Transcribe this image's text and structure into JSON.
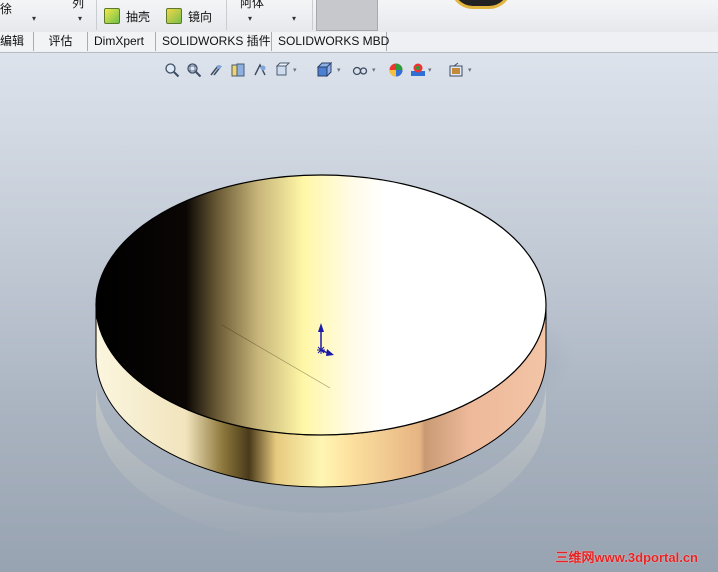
{
  "ribbon": {
    "partial_left": "徐",
    "partial_top1": "列",
    "shell_label": "抽壳",
    "mirror_label": "镜向",
    "partial_top2": "阿体",
    "dropdown_glyph": "▾"
  },
  "tabs": [
    {
      "label": "编辑"
    },
    {
      "label": "评估"
    },
    {
      "label": "DimXpert"
    },
    {
      "label": "SOLIDWORKS 插件"
    },
    {
      "label": "SOLIDWORKS MBD"
    }
  ],
  "heads_up_toolbar": {
    "icons": [
      "zoom-to-fit-icon",
      "zoom-to-area-icon",
      "previous-view-icon",
      "section-view-icon",
      "dynamic-annotation-icon",
      "view-orientation-icon",
      "display-style-icon",
      "hide-show-items-icon",
      "edit-appearance-icon",
      "apply-scene-icon",
      "view-settings-icon"
    ],
    "dropdown_glyph": "▾"
  },
  "watermark": "三维网www.3dportal.cn",
  "colors": {
    "watermark": "#e82020",
    "axis_triad": "#1a1aa8"
  }
}
